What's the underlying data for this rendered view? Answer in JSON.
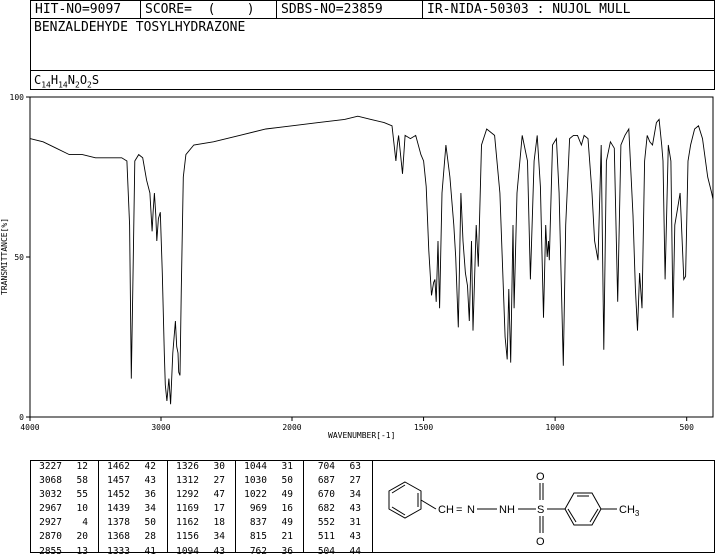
{
  "header": {
    "hit_no": "HIT-NO=9097",
    "score": "SCORE=  (    )",
    "sdbs_no": "SDBS-NO=23859",
    "ir_code": "IR-NIDA-50303 : NUJOL MULL",
    "compound_name": "BENZALDEHYDE TOSYLHYDRAZONE",
    "formula_parts": [
      {
        "text": "C",
        "sub": "14"
      },
      {
        "text": "H",
        "sub": "14"
      },
      {
        "text": "N",
        "sub": "2"
      },
      {
        "text": "O",
        "sub": "2"
      },
      {
        "text": "S",
        "sub": ""
      }
    ]
  },
  "chart_data": {
    "type": "line",
    "xlabel": "WAVENUMBER[-1]",
    "ylabel": "TRANSMITTANCE[%]",
    "xlim": [
      4000,
      400
    ],
    "ylim": [
      0,
      100
    ],
    "x_ticks": [
      4000,
      3000,
      2000,
      1500,
      1000,
      500
    ],
    "y_ticks": [
      0,
      50,
      100
    ],
    "series": [
      {
        "points": [
          [
            4000,
            87
          ],
          [
            3900,
            86
          ],
          [
            3800,
            84
          ],
          [
            3700,
            82
          ],
          [
            3600,
            82
          ],
          [
            3500,
            81
          ],
          [
            3400,
            81
          ],
          [
            3300,
            81
          ],
          [
            3260,
            80
          ],
          [
            3240,
            60
          ],
          [
            3227,
            12
          ],
          [
            3215,
            40
          ],
          [
            3200,
            80
          ],
          [
            3170,
            82
          ],
          [
            3140,
            81
          ],
          [
            3110,
            74
          ],
          [
            3085,
            70
          ],
          [
            3068,
            58
          ],
          [
            3060,
            64
          ],
          [
            3050,
            70
          ],
          [
            3040,
            63
          ],
          [
            3032,
            55
          ],
          [
            3020,
            62
          ],
          [
            3005,
            64
          ],
          [
            2990,
            45
          ],
          [
            2975,
            20
          ],
          [
            2967,
            10
          ],
          [
            2955,
            5
          ],
          [
            2940,
            12
          ],
          [
            2927,
            4
          ],
          [
            2910,
            20
          ],
          [
            2890,
            30
          ],
          [
            2880,
            22
          ],
          [
            2870,
            20
          ],
          [
            2865,
            14
          ],
          [
            2855,
            13
          ],
          [
            2845,
            40
          ],
          [
            2830,
            75
          ],
          [
            2810,
            82
          ],
          [
            2750,
            85
          ],
          [
            2600,
            86
          ],
          [
            2400,
            88
          ],
          [
            2200,
            90
          ],
          [
            2000,
            91
          ],
          [
            1900,
            92
          ],
          [
            1800,
            93
          ],
          [
            1750,
            94
          ],
          [
            1700,
            93
          ],
          [
            1650,
            92
          ],
          [
            1620,
            91
          ],
          [
            1605,
            80
          ],
          [
            1600,
            85
          ],
          [
            1595,
            88
          ],
          [
            1580,
            76
          ],
          [
            1570,
            88
          ],
          [
            1550,
            87
          ],
          [
            1530,
            88
          ],
          [
            1510,
            82
          ],
          [
            1500,
            80
          ],
          [
            1490,
            72
          ],
          [
            1480,
            52
          ],
          [
            1470,
            38
          ],
          [
            1462,
            42
          ],
          [
            1457,
            43
          ],
          [
            1452,
            36
          ],
          [
            1445,
            55
          ],
          [
            1439,
            34
          ],
          [
            1430,
            70
          ],
          [
            1415,
            85
          ],
          [
            1400,
            75
          ],
          [
            1385,
            60
          ],
          [
            1378,
            50
          ],
          [
            1368,
            28
          ],
          [
            1358,
            70
          ],
          [
            1350,
            55
          ],
          [
            1341,
            45
          ],
          [
            1333,
            41
          ],
          [
            1326,
            30
          ],
          [
            1318,
            55
          ],
          [
            1312,
            27
          ],
          [
            1300,
            60
          ],
          [
            1292,
            47
          ],
          [
            1280,
            85
          ],
          [
            1260,
            90
          ],
          [
            1230,
            88
          ],
          [
            1210,
            70
          ],
          [
            1190,
            25
          ],
          [
            1182,
            18
          ],
          [
            1176,
            40
          ],
          [
            1169,
            17
          ],
          [
            1160,
            60
          ],
          [
            1156,
            34
          ],
          [
            1145,
            70
          ],
          [
            1125,
            88
          ],
          [
            1105,
            80
          ],
          [
            1094,
            43
          ],
          [
            1080,
            80
          ],
          [
            1068,
            88
          ],
          [
            1056,
            72
          ],
          [
            1044,
            31
          ],
          [
            1036,
            60
          ],
          [
            1030,
            50
          ],
          [
            1025,
            55
          ],
          [
            1022,
            49
          ],
          [
            1010,
            85
          ],
          [
            995,
            87
          ],
          [
            985,
            70
          ],
          [
            969,
            16
          ],
          [
            960,
            60
          ],
          [
            945,
            87
          ],
          [
            930,
            88
          ],
          [
            915,
            88
          ],
          [
            900,
            85
          ],
          [
            890,
            88
          ],
          [
            875,
            87
          ],
          [
            860,
            70
          ],
          [
            850,
            55
          ],
          [
            837,
            49
          ],
          [
            825,
            85
          ],
          [
            815,
            21
          ],
          [
            805,
            80
          ],
          [
            790,
            86
          ],
          [
            775,
            84
          ],
          [
            762,
            36
          ],
          [
            750,
            85
          ],
          [
            735,
            88
          ],
          [
            720,
            90
          ],
          [
            704,
            63
          ],
          [
            695,
            40
          ],
          [
            687,
            27
          ],
          [
            679,
            45
          ],
          [
            670,
            34
          ],
          [
            660,
            80
          ],
          [
            650,
            88
          ],
          [
            640,
            86
          ],
          [
            630,
            85
          ],
          [
            615,
            92
          ],
          [
            605,
            93
          ],
          [
            595,
            85
          ],
          [
            590,
            80
          ],
          [
            582,
            43
          ],
          [
            570,
            85
          ],
          [
            560,
            80
          ],
          [
            552,
            31
          ],
          [
            545,
            60
          ],
          [
            535,
            65
          ],
          [
            525,
            70
          ],
          [
            511,
            43
          ],
          [
            504,
            44
          ],
          [
            495,
            80
          ],
          [
            485,
            85
          ],
          [
            470,
            90
          ],
          [
            455,
            91
          ],
          [
            440,
            87
          ],
          [
            420,
            75
          ],
          [
            405,
            70
          ],
          [
            400,
            68
          ]
        ]
      }
    ]
  },
  "peak_table": {
    "columns": [
      [
        [
          "3227",
          "12"
        ],
        [
          "3068",
          "58"
        ],
        [
          "3032",
          "55"
        ],
        [
          "2967",
          "10"
        ],
        [
          "2927",
          "4"
        ],
        [
          "2870",
          "20"
        ],
        [
          "2855",
          "13"
        ]
      ],
      [
        [
          "1462",
          "42"
        ],
        [
          "1457",
          "43"
        ],
        [
          "1452",
          "36"
        ],
        [
          "1439",
          "34"
        ],
        [
          "1378",
          "50"
        ],
        [
          "1368",
          "28"
        ],
        [
          "1333",
          "41"
        ]
      ],
      [
        [
          "1326",
          "30"
        ],
        [
          "1312",
          "27"
        ],
        [
          "1292",
          "47"
        ],
        [
          "1169",
          "17"
        ],
        [
          "1162",
          "18"
        ],
        [
          "1156",
          "34"
        ],
        [
          "1094",
          "43"
        ]
      ],
      [
        [
          "1044",
          "31"
        ],
        [
          "1030",
          "50"
        ],
        [
          "1022",
          "49"
        ],
        [
          "969",
          "16"
        ],
        [
          "837",
          "49"
        ],
        [
          "815",
          "21"
        ],
        [
          "762",
          "36"
        ]
      ],
      [
        [
          "704",
          "63"
        ],
        [
          "687",
          "27"
        ],
        [
          "670",
          "34"
        ],
        [
          "682",
          "43"
        ],
        [
          "552",
          "31"
        ],
        [
          "511",
          "43"
        ],
        [
          "504",
          "44"
        ]
      ]
    ]
  },
  "structure": {
    "ch_label": "CH",
    "eq": "=",
    "n1": "N",
    "nh": "NH",
    "s": "S",
    "o_top": "O",
    "o_bottom": "O",
    "ch3": "CH",
    "ch3_sub": "3"
  }
}
